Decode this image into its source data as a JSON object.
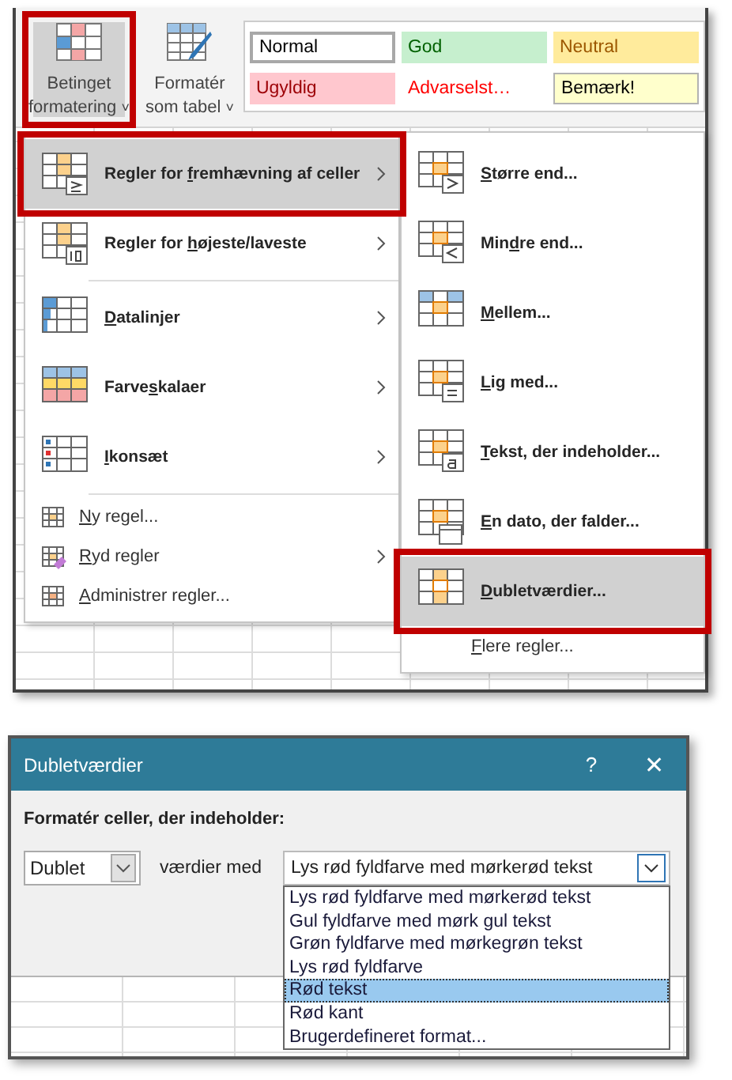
{
  "ribbon": {
    "buttons": [
      {
        "label_lines": [
          "Betinget",
          "formatering"
        ],
        "caret": "˅",
        "selected": true,
        "highlighted": true
      },
      {
        "label_lines": [
          "Formatér",
          "som tabel"
        ],
        "caret": "˅",
        "selected": false,
        "highlighted": false
      }
    ],
    "styles": [
      {
        "label": "Normal",
        "kind": "normal"
      },
      {
        "label": "God",
        "kind": "good"
      },
      {
        "label": "Neutral",
        "kind": "neutral"
      },
      {
        "label": "Ugyldig",
        "kind": "bad"
      },
      {
        "label": "Advarselst…",
        "kind": "warning"
      },
      {
        "label": "Bemærk!",
        "kind": "note"
      }
    ]
  },
  "menu": {
    "items": [
      {
        "kind": "large",
        "pre": "Regler for ",
        "key": "f",
        "post": "remhævning af celler",
        "submenu": true,
        "divider_after": false,
        "selected": true,
        "highlighted": true
      },
      {
        "kind": "large",
        "pre": "Regler for ",
        "key": "h",
        "post": "øjeste/laveste",
        "submenu": true,
        "divider_after": true,
        "selected": false,
        "highlighted": false
      },
      {
        "kind": "large",
        "key": "D",
        "post": "atalinjer",
        "submenu": true,
        "divider_after": false,
        "selected": false,
        "highlighted": false
      },
      {
        "kind": "large",
        "pre": "Farve",
        "key": "s",
        "post": "kalaer",
        "submenu": true,
        "divider_after": false,
        "selected": false,
        "highlighted": false
      },
      {
        "kind": "large",
        "key": "I",
        "post": "konsæt",
        "submenu": true,
        "divider_after": true,
        "selected": false,
        "highlighted": false
      },
      {
        "kind": "small",
        "key": "N",
        "post": "y regel...",
        "submenu": false,
        "divider_after": false,
        "selected": false,
        "highlighted": false
      },
      {
        "kind": "small",
        "key": "R",
        "post": "yd regler",
        "submenu": true,
        "divider_after": false,
        "selected": false,
        "highlighted": false
      },
      {
        "kind": "small",
        "key": "A",
        "post": "dministrer regler...",
        "submenu": false,
        "divider_after": false,
        "selected": false,
        "highlighted": false
      }
    ]
  },
  "submenu": {
    "items": [
      {
        "kind": "large",
        "key": "S",
        "post": "tørre end...",
        "selected": false,
        "highlighted": false
      },
      {
        "kind": "large",
        "pre": "Min",
        "key": "d",
        "post": "re end...",
        "selected": false,
        "highlighted": false
      },
      {
        "kind": "large",
        "key": "M",
        "post": "ellem...",
        "selected": false,
        "highlighted": false
      },
      {
        "kind": "large",
        "key": "L",
        "post": "ig med...",
        "selected": false,
        "highlighted": false
      },
      {
        "kind": "large",
        "key": "T",
        "post": "ekst, der indeholder...",
        "selected": false,
        "highlighted": false
      },
      {
        "kind": "large",
        "key": "E",
        "post": "n dato, der falder...",
        "selected": false,
        "highlighted": false
      },
      {
        "kind": "large",
        "key": "D",
        "post": "ubletværdier...",
        "selected": true,
        "highlighted": true
      },
      {
        "kind": "small",
        "key": "F",
        "post": "lere regler...",
        "selected": false,
        "highlighted": false
      }
    ]
  },
  "dialog": {
    "title": "Dubletværdier",
    "help": "?",
    "close": "✕",
    "prompt": "Formatér celler, der indeholder:",
    "type_select": {
      "value": "Dublet"
    },
    "connector": "værdier med",
    "format_select": {
      "value": "Lys rød fyldfarve med mørkerød tekst",
      "expanded": true
    },
    "options": [
      {
        "label": "Lys rød fyldfarve med mørkerød tekst",
        "selected": false
      },
      {
        "label": "Gul fyldfarve med mørk gul tekst",
        "selected": false
      },
      {
        "label": "Grøn fyldfarve med mørkegrøn tekst",
        "selected": false
      },
      {
        "label": "Lys rød fyldfarve",
        "selected": false
      },
      {
        "label": "Rød tekst",
        "selected": true
      },
      {
        "label": "Rød kant",
        "selected": false
      },
      {
        "label": "Brugerdefineret format...",
        "selected": false
      }
    ]
  }
}
